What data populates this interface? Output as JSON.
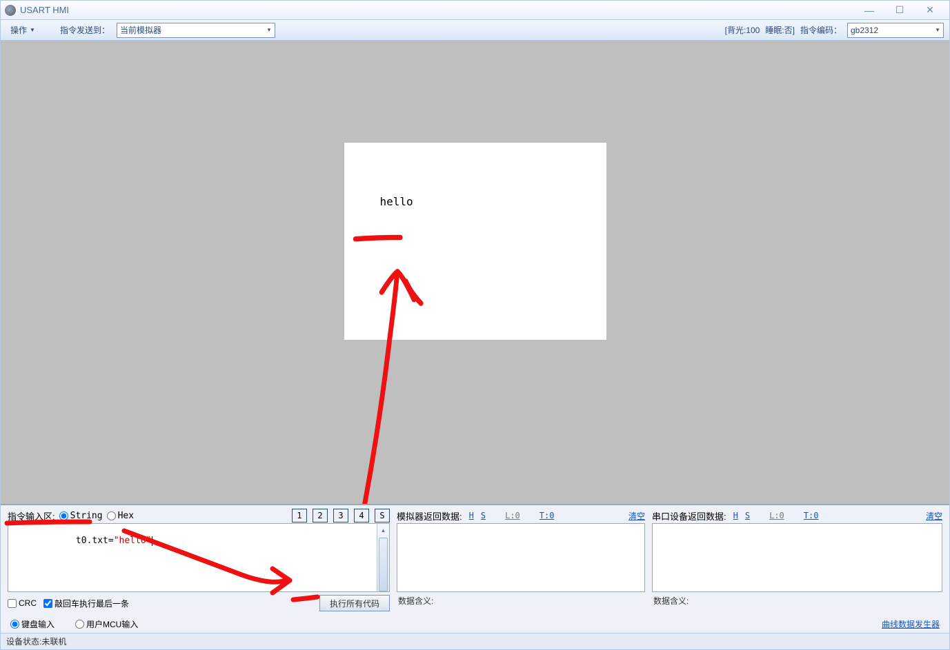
{
  "window": {
    "title": "USART HMI"
  },
  "toolbar": {
    "actions_label": "操作",
    "send_to_label": "指令发送到：",
    "send_to_value": "当前模拟器",
    "backlight_label": "[背光:100",
    "sleep_label": "睡眠:否]",
    "encoding_label": "指令编码：",
    "encoding_value": "gb2312"
  },
  "sim": {
    "display_text": "hello"
  },
  "input_area": {
    "title": "指令输入区:",
    "radio_string": "String",
    "radio_hex": "Hex",
    "buttons": [
      "1",
      "2",
      "3",
      "4",
      "S"
    ],
    "code_plain": "t0.txt=",
    "code_string": "\"hello\"",
    "crc_label": "CRC",
    "enter_exec_label": "敲回车执行最后一条",
    "run_all": "执行所有代码"
  },
  "sim_return": {
    "title": "模拟器返回数据:",
    "link_h": "H",
    "link_s": "S",
    "link_l": "L:0",
    "link_t": "T:0",
    "clear": "清空",
    "meaning_label": "数据含义:"
  },
  "serial_return": {
    "title": "串口设备返回数据:",
    "link_h": "H",
    "link_s": "S",
    "link_l": "L:0",
    "link_t": "T:0",
    "clear": "清空",
    "meaning_label": "数据含义:"
  },
  "input_mode": {
    "keyboard": "键盘输入",
    "mcu": "用户MCU输入"
  },
  "status": {
    "device_status": "设备状态:未联机",
    "curve_gen": "曲线数据发生器"
  }
}
